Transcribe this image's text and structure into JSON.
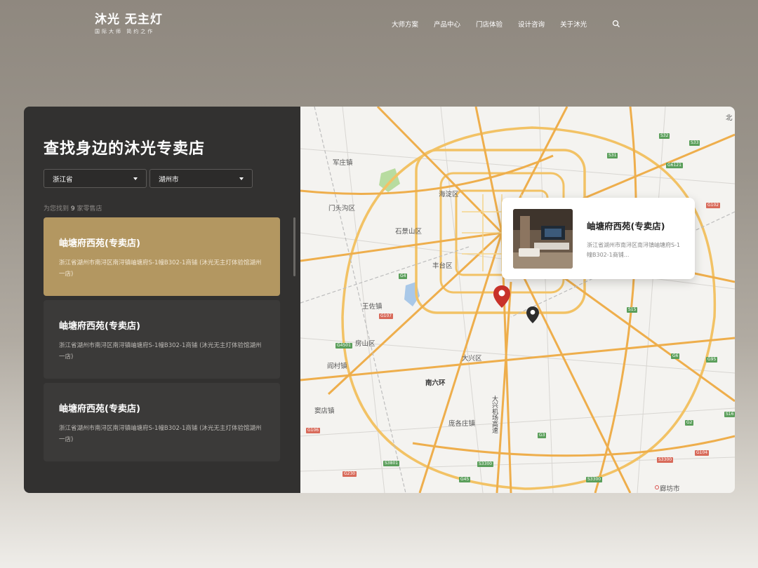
{
  "header": {
    "logo_main": "沐光 无主灯",
    "logo_sub": "国际大师 简约之作",
    "nav": [
      "大师方案",
      "产品中心",
      "门店体验",
      "设计咨询",
      "关于沐光"
    ]
  },
  "panel": {
    "title": "查找身边的沐光专卖店",
    "province": "浙江省",
    "city": "湖州市",
    "found_prefix": "为您找到",
    "found_count": "9",
    "found_suffix": "家零售店"
  },
  "stores": [
    {
      "name": "岫塘府西苑(专卖店)",
      "address": "浙江省湖州市南浔区南浔镇岫塘府S-1幢B302-1商铺 (沐光无主灯体验馆湖州一店)"
    },
    {
      "name": "岫塘府西苑(专卖店)",
      "address": "浙江省湖州市南浔区南浔镇岫塘府S-1幢B302-1商铺 (沐光无主灯体验馆湖州一店)"
    },
    {
      "name": "岫塘府西苑(专卖店)",
      "address": "浙江省湖州市南浔区南浔镇岫塘府S-1幢B302-1商铺 (沐光无主灯体验馆湖州一店)"
    }
  ],
  "popup": {
    "name": "岫塘府西苑(专卖店)",
    "address": "浙江省湖州市南浔区南浔镇岫塘府S-1幢B302-1商铺..."
  },
  "map": {
    "labels": [
      "军庄镇",
      "海淀区",
      "门头沟区",
      "石景山区",
      "丰台区",
      "王佐镇",
      "房山区",
      "阎村镇",
      "大兴区",
      "南六环",
      "窦店镇",
      "庞各庄镇",
      "大兴机场高速",
      "廊坊市",
      "北"
    ],
    "badges": [
      "S32",
      "S33",
      "S31",
      "G6121",
      "G102",
      "G4",
      "G107",
      "S15",
      "G4501",
      "G95",
      "G6",
      "S16",
      "S3801",
      "S3300",
      "G106",
      "G3",
      "G230",
      "S3300",
      "G45",
      "S3300",
      "G104",
      "G2"
    ]
  },
  "colors": {
    "accent": "#b39761",
    "panel": "#323130",
    "pin_active": "#c8322a",
    "pin": "#2d2d2d"
  }
}
